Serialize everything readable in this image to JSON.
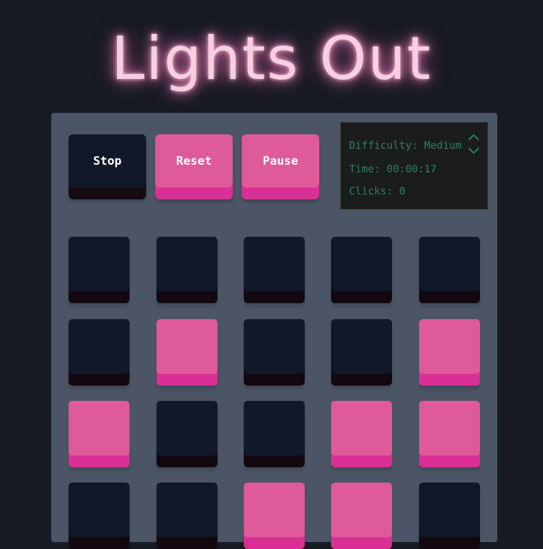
{
  "title": "Lights Out",
  "buttons": {
    "stop": "Stop",
    "reset": "Reset",
    "pause": "Pause"
  },
  "info": {
    "difficulty": "Difficulty: Medium",
    "time": "Time: 00:00:17",
    "clicks": "Clicks: 0"
  },
  "colors": {
    "light_on": "#de5a99",
    "light_off": "#111827",
    "accent": "#db2f95",
    "panel": "#4c5566"
  },
  "grid": {
    "rows": [
      [
        0,
        0,
        0,
        0,
        0
      ],
      [
        0,
        1,
        0,
        0,
        1
      ],
      [
        1,
        0,
        0,
        1,
        1
      ],
      [
        0,
        0,
        1,
        1,
        0
      ]
    ]
  }
}
